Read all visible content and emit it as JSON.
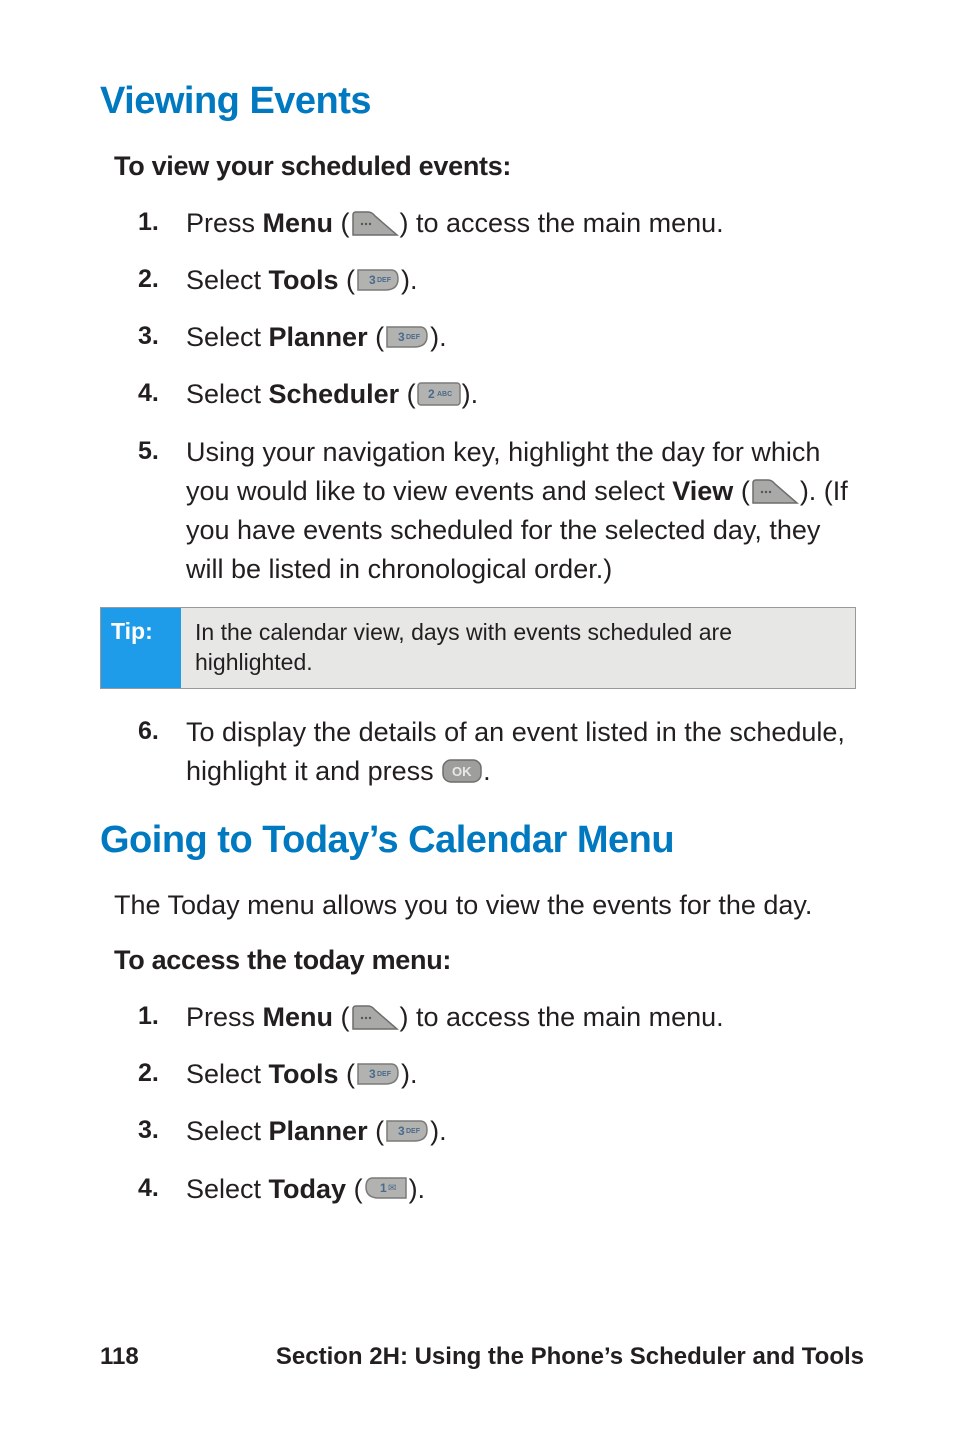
{
  "section1": {
    "heading": "Viewing Events",
    "sub": "To view your scheduled events:",
    "steps": {
      "s1": {
        "n": "1.",
        "a": "Press ",
        "b": "Menu",
        "c": " (",
        "d": ") to access the main menu."
      },
      "s2": {
        "n": "2.",
        "a": "Select ",
        "b": "Tools",
        "c": " (",
        "d": ")."
      },
      "s3": {
        "n": "3.",
        "a": "Select ",
        "b": "Planner",
        "c": " (",
        "d": ")."
      },
      "s4": {
        "n": "4.",
        "a": "Select ",
        "b": "Scheduler",
        "c": " (",
        "d": ")."
      },
      "s5": {
        "n": "5.",
        "a": "Using your navigation key, highlight the day for which you would like to view events and select ",
        "b": "View",
        "c": " (",
        "d": "). (If you have events scheduled for the selected day, they will be listed in chronological order.)"
      },
      "s6": {
        "n": "6.",
        "a": "To display the details of an event listed in the schedule, highlight it and press ",
        "d": "."
      }
    }
  },
  "tip": {
    "label": "Tip:",
    "text": "In the calendar view, days with events scheduled are highlighted."
  },
  "section2": {
    "heading": "Going to Today’s Calendar Menu",
    "intro": "The Today menu allows you to view the events for the day.",
    "sub": "To access the today menu:",
    "steps": {
      "s1": {
        "n": "1.",
        "a": "Press ",
        "b": "Menu",
        "c": " (",
        "d": ") to access the main menu."
      },
      "s2": {
        "n": "2.",
        "a": "Select ",
        "b": "Tools",
        "c": " (",
        "d": ")."
      },
      "s3": {
        "n": "3.",
        "a": "Select ",
        "b": "Planner",
        "c": " (",
        "d": ")."
      },
      "s4": {
        "n": "4.",
        "a": "Select ",
        "b": "Today",
        "c": " (",
        "d": ")."
      }
    }
  },
  "footer": {
    "page": "118",
    "title": "Section 2H: Using the Phone’s Scheduler and Tools"
  }
}
